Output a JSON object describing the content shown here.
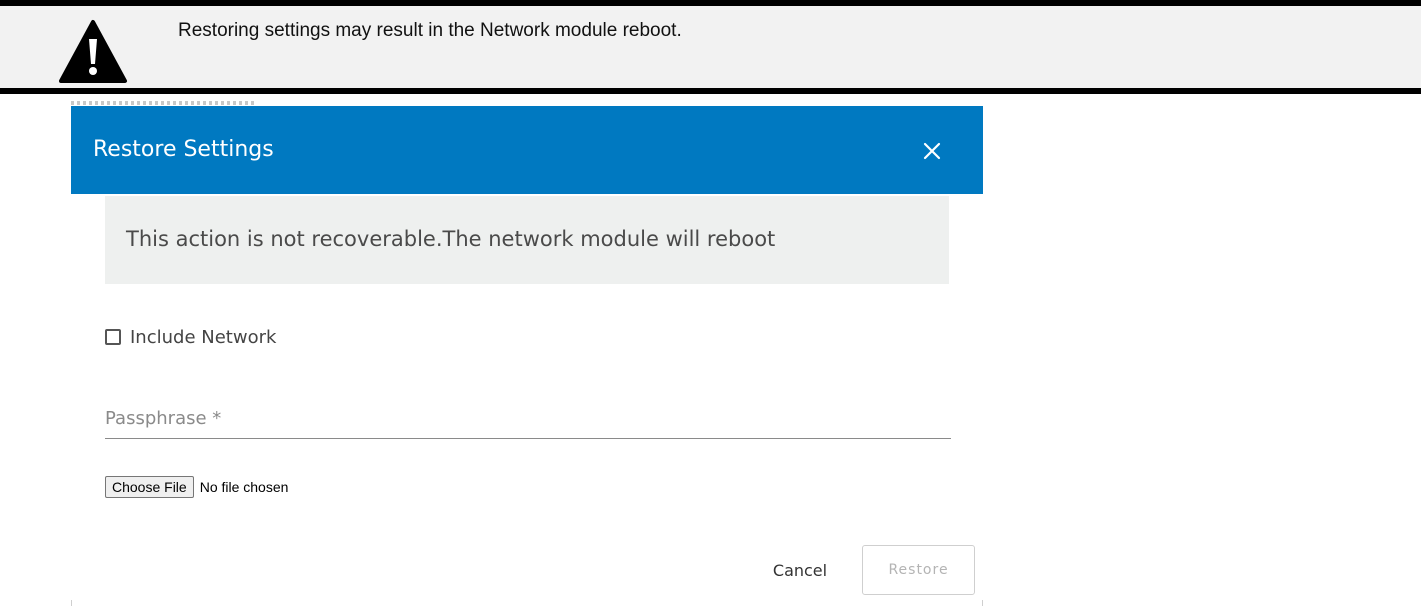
{
  "banner": {
    "icon": "warning-triangle-icon",
    "text": "Restoring settings may result in the Network module reboot."
  },
  "dialog": {
    "title": "Restore Settings",
    "close_icon": "close-icon",
    "header_color": "#0079c1",
    "alert_text": "This action is not recoverable.The network module will reboot",
    "include_network_label": "Include Network",
    "include_network_checked": false,
    "passphrase_placeholder": "Passphrase *",
    "passphrase_value": "",
    "choose_file_label": "Choose File",
    "file_status": "No file chosen",
    "cancel_label": "Cancel",
    "restore_label": "Restore"
  }
}
